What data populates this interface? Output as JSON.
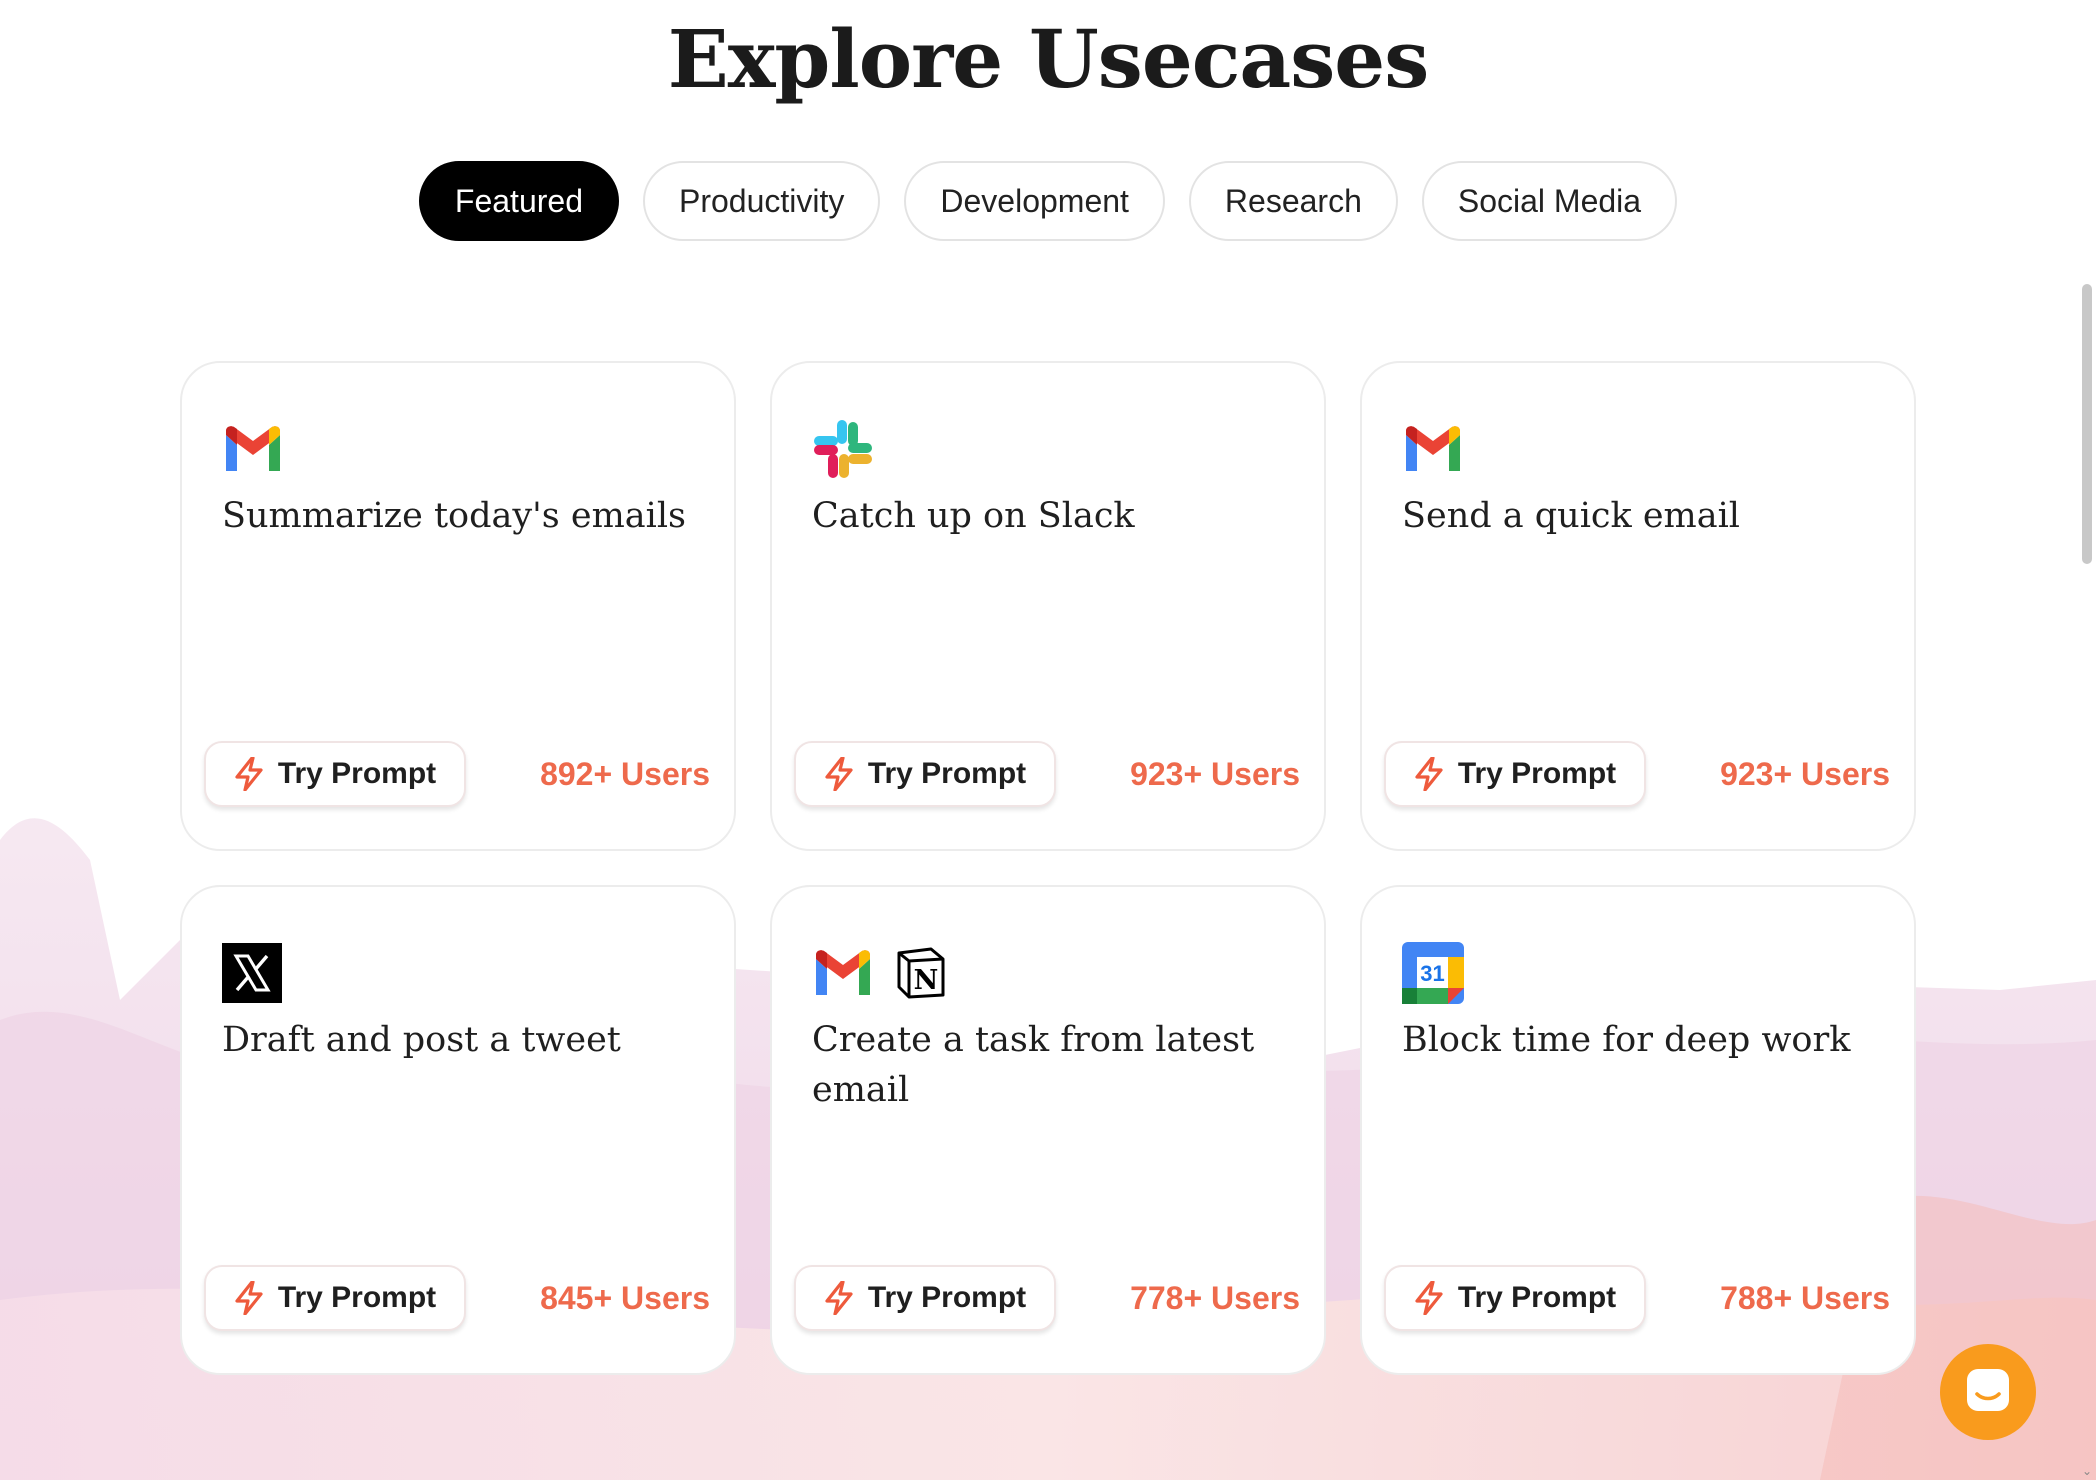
{
  "page": {
    "title": "Explore Usecases"
  },
  "tabs": [
    {
      "label": "Featured",
      "active": true
    },
    {
      "label": "Productivity",
      "active": false
    },
    {
      "label": "Development",
      "active": false
    },
    {
      "label": "Research",
      "active": false
    },
    {
      "label": "Social Media",
      "active": false
    }
  ],
  "cards": [
    {
      "icons": [
        "gmail-icon"
      ],
      "title": "Summarize today's emails",
      "button_label": "Try Prompt",
      "users": "892+ Users"
    },
    {
      "icons": [
        "slack-icon"
      ],
      "title": "Catch up on Slack",
      "button_label": "Try Prompt",
      "users": "923+ Users"
    },
    {
      "icons": [
        "gmail-icon"
      ],
      "title": "Send a quick email",
      "button_label": "Try Prompt",
      "users": "923+ Users"
    },
    {
      "icons": [
        "x-icon"
      ],
      "title": "Draft and post a tweet",
      "button_label": "Try Prompt",
      "users": "845+ Users"
    },
    {
      "icons": [
        "gmail-icon",
        "notion-icon"
      ],
      "title": "Create a task from latest email",
      "button_label": "Try Prompt",
      "users": "778+ Users"
    },
    {
      "icons": [
        "google-calendar-icon"
      ],
      "title": "Block time for deep work",
      "button_label": "Try Prompt",
      "users": "788+ Users"
    }
  ],
  "calendar_icon_text": "31",
  "notion_icon_text": "N",
  "colors": {
    "accent_orange": "#ee6a4c",
    "active_tab_bg": "#000000",
    "chat_button": "#f99b1d"
  }
}
